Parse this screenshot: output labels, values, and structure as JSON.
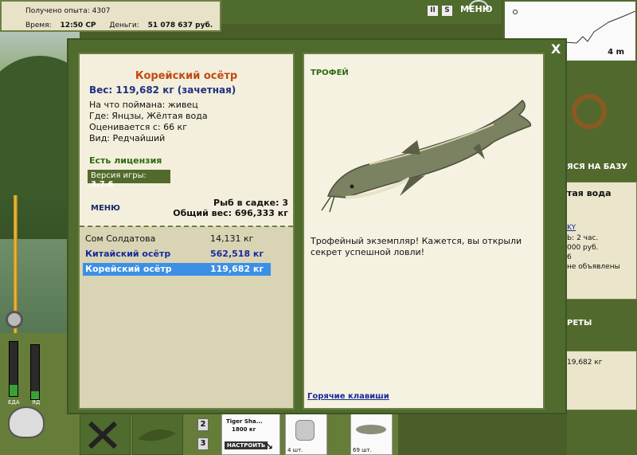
{
  "hud": {
    "experience_label": "Получено опыта:",
    "experience_value": "4307",
    "time_label": "Время:",
    "time_value": "12:50 СР",
    "money_label": "Деньги:",
    "money_value": "51 078 637 руб.",
    "menu_label": "МЕНЮ",
    "pause_glyph": "II",
    "sound_glyph": "S"
  },
  "sonar": {
    "depth": "4 m"
  },
  "right_panel": {
    "base_heading": "ЯСЯ НА БАЗУ",
    "location_partial": "тая вода",
    "link_partial": "KY",
    "line1": "Ь: 2 час.",
    "line2": "000 руб.",
    "line3": "6",
    "line4": "не объявлены",
    "secrets_heading": "РЕТЫ",
    "weight_partial": "19,682 кг"
  },
  "dialog": {
    "close_label": "X",
    "fish_name": "Корейский осётр",
    "weight_text": "Вес: 119,682 кг (зачетная)",
    "caught_on": "На что поймана: живец",
    "where": "Где: Янцзы, Жёлтая вода",
    "rated_from": "Оценивается с: 66 кг",
    "species_kind": "Вид: Редчайший",
    "license": "Есть лицензия",
    "version_label": "Версия игры:",
    "version_value": "3.7.6",
    "menu_label": "МЕНЮ",
    "fish_in_cage": "Рыб в садке: 3",
    "total_weight": "Общий вес: 696,333 кг",
    "catch_list": [
      {
        "name": "Сом Солдатова",
        "weight": "14,131 кг",
        "style": "normal"
      },
      {
        "name": "Китайский осётр",
        "weight": "562,518 кг",
        "style": "bold"
      },
      {
        "name": "Корейский осётр",
        "weight": "119,682 кг",
        "style": "selected"
      }
    ],
    "trophy_label": "ТРОФЕЙ",
    "trophy_message": "Трофейный экземпляр! Кажется, вы открыли секрет успешной ловли!",
    "hotkeys": "Горячие клавиши"
  },
  "bottom": {
    "food_label": "ЕДА",
    "poison_label": "ЯД",
    "slot2": "2",
    "slot3": "3",
    "lure_name": "Tiger Sha...",
    "lure_weight": "1800 кг",
    "setup_label": "НАСТРОИТЬ",
    "bait1_count": "4 шт.",
    "bait2_count": "69 шт.",
    "food_level": 0.2,
    "poison_level": 0.15
  },
  "colors": {
    "panel_green": "#4f6b2e",
    "accent_orange": "#c04a10",
    "link_blue": "#1a2a9a",
    "selected_blue": "#3b8fe6"
  }
}
